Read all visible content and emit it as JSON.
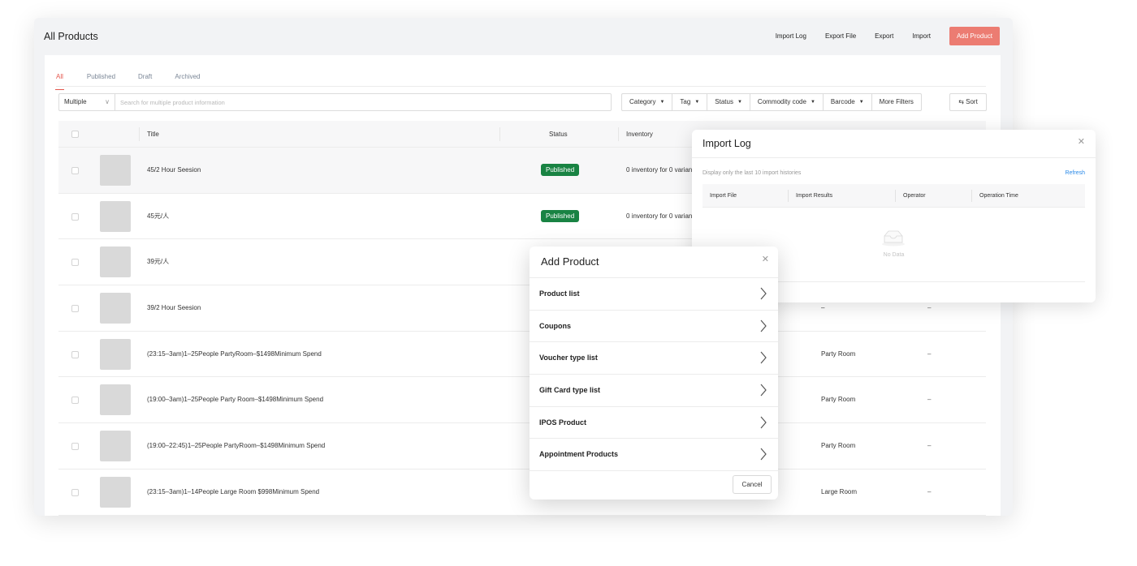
{
  "header": {
    "title": "All Products",
    "actions": [
      "Import Log",
      "Export File",
      "Export",
      "Import"
    ],
    "primary_action": "Add Product"
  },
  "tabs": [
    "All",
    "Published",
    "Draft",
    "Archived"
  ],
  "filters": {
    "multiple_select": "Multiple",
    "search_placeholder": "Search for multiple product information",
    "dropdowns": [
      "Category",
      "Tag",
      "Status",
      "Commodity code",
      "Barcode"
    ],
    "more_filters": "More Filters",
    "sort": "⇆ Sort"
  },
  "table": {
    "columns": [
      "Title",
      "Status",
      "Inventory"
    ],
    "rows": [
      {
        "title": "45/2 Hour Seesion",
        "status": "Published",
        "inventory": "0 inventory for 0 variants",
        "category": "",
        "dash": ""
      },
      {
        "title": "45元/人",
        "status": "Published",
        "inventory": "0 inventory for 0 variants",
        "category": "",
        "dash": ""
      },
      {
        "title": "39元/人",
        "status": "",
        "inventory": "",
        "category": "",
        "dash": ""
      },
      {
        "title": "39/2 Hour Seesion",
        "status": "",
        "inventory": "",
        "category": "–",
        "dash": "–"
      },
      {
        "title": "(23:15–3am)1–25People PartyRoom–$1498Minimum Spend",
        "status": "",
        "inventory": "",
        "category": "Party Room",
        "dash": "–"
      },
      {
        "title": "(19:00–3am)1–25People Party Room–$1498Minimum Spend",
        "status": "",
        "inventory": "",
        "category": "Party Room",
        "dash": "–"
      },
      {
        "title": "(19:00–22:45)1–25People PartyRoom–$1498Minimum Spend",
        "status": "",
        "inventory": "",
        "category": "Party Room",
        "dash": "–"
      },
      {
        "title": "(23:15–3am)1–14People Large Room $998Minimum Spend",
        "status": "",
        "inventory": "",
        "category": "Large Room",
        "dash": "–"
      }
    ]
  },
  "import_log": {
    "title": "Import Log",
    "note": "Display only the last 10 import histories",
    "refresh": "Refresh",
    "columns": [
      "Import File",
      "Import Results",
      "Operator",
      "Operation Time"
    ],
    "empty_text": "No Data"
  },
  "add_product": {
    "title": "Add Product",
    "items": [
      "Product list",
      "Coupons",
      "Voucher type list",
      "Gift Card type list",
      "IPOS Product",
      "Appointment Products"
    ],
    "cancel": "Cancel"
  },
  "colors": {
    "primary": "#ec7c72",
    "tab_active": "#e4574d",
    "published_badge": "#198343",
    "link": "#2a8ae8"
  }
}
